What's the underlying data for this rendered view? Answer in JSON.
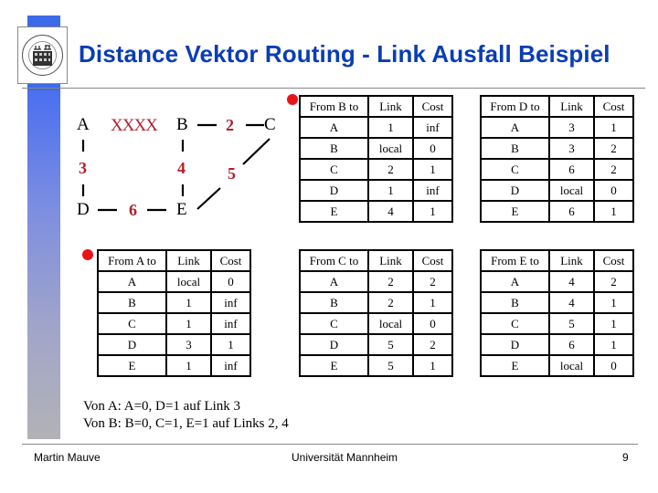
{
  "slide": {
    "title": "Distance Vektor Routing - Link Ausfall Beispiel",
    "logo": "universitaet-mannheim-seal-icon",
    "accent_color": "#3c6ae8",
    "title_color": "#0a3db4"
  },
  "network": {
    "nodes": [
      "A",
      "B",
      "C",
      "D",
      "E"
    ],
    "links": [
      {
        "id": "1",
        "from": "A",
        "to": "B",
        "label": "XXXX",
        "failed": true
      },
      {
        "id": "2",
        "from": "B",
        "to": "C",
        "label": "2"
      },
      {
        "id": "3",
        "from": "A",
        "to": "D",
        "label": "3"
      },
      {
        "id": "4",
        "from": "B",
        "to": "E",
        "label": "4"
      },
      {
        "id": "5",
        "from": "E",
        "to": "C",
        "label": "5"
      },
      {
        "id": "6",
        "from": "D",
        "to": "E",
        "label": "6"
      }
    ],
    "link_label_color": "#b0202a"
  },
  "tables": {
    "B": {
      "header": [
        "From B to",
        "Link",
        "Cost"
      ],
      "rows": [
        [
          "A",
          "1",
          "inf"
        ],
        [
          "B",
          "local",
          "0"
        ],
        [
          "C",
          "2",
          "1"
        ],
        [
          "D",
          "1",
          "inf"
        ],
        [
          "E",
          "4",
          "1"
        ]
      ],
      "highlighted": true
    },
    "D": {
      "header": [
        "From D to",
        "Link",
        "Cost"
      ],
      "rows": [
        [
          "A",
          "3",
          "1"
        ],
        [
          "B",
          "3",
          "2"
        ],
        [
          "C",
          "6",
          "2"
        ],
        [
          "D",
          "local",
          "0"
        ],
        [
          "E",
          "6",
          "1"
        ]
      ]
    },
    "A": {
      "header": [
        "From A to",
        "Link",
        "Cost"
      ],
      "rows": [
        [
          "A",
          "local",
          "0"
        ],
        [
          "B",
          "1",
          "inf"
        ],
        [
          "C",
          "1",
          "inf"
        ],
        [
          "D",
          "3",
          "1"
        ],
        [
          "E",
          "1",
          "inf"
        ]
      ],
      "highlighted": true
    },
    "C": {
      "header": [
        "From C to",
        "Link",
        "Cost"
      ],
      "rows": [
        [
          "A",
          "2",
          "2"
        ],
        [
          "B",
          "2",
          "1"
        ],
        [
          "C",
          "local",
          "0"
        ],
        [
          "D",
          "5",
          "2"
        ],
        [
          "E",
          "5",
          "1"
        ]
      ]
    },
    "E": {
      "header": [
        "From E to",
        "Link",
        "Cost"
      ],
      "rows": [
        [
          "A",
          "4",
          "2"
        ],
        [
          "B",
          "4",
          "1"
        ],
        [
          "C",
          "5",
          "1"
        ],
        [
          "D",
          "6",
          "1"
        ],
        [
          "E",
          "local",
          "0"
        ]
      ]
    }
  },
  "notes": [
    "Von A: A=0, D=1 auf Link 3",
    "Von B: B=0, C=1, E=1 auf Links 2, 4"
  ],
  "footer": {
    "author": "Martin Mauve",
    "institution": "Universität Mannheim",
    "page_number": "9"
  }
}
